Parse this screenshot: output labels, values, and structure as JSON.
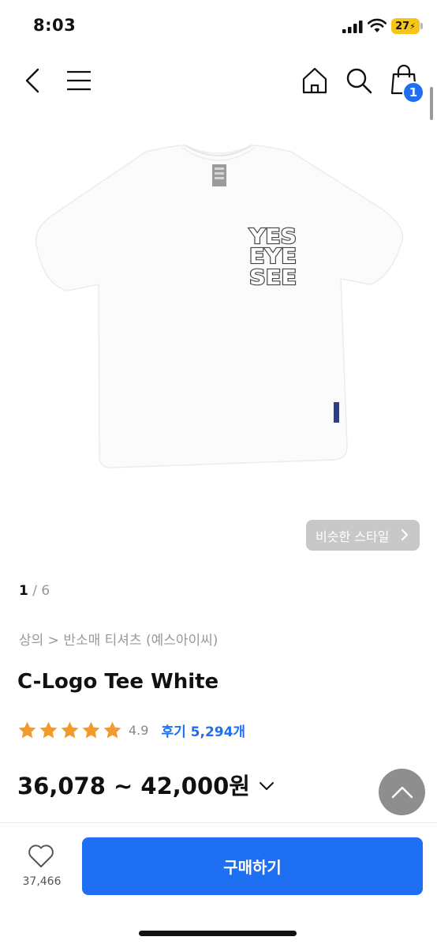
{
  "status_bar": {
    "time": "8:03",
    "battery": "27"
  },
  "nav": {
    "cart_count": "1"
  },
  "product": {
    "graphic_text": [
      "YES",
      "EYE",
      "SEE"
    ],
    "similar_style_label": "비슷한 스타일",
    "pager_current": "1",
    "pager_total": " / 6",
    "breadcrumb": "상의 > 반소매 티셔츠 (예스아이씨)",
    "title": "C-Logo Tee White",
    "rating": 4.9,
    "rating_label": "4.9",
    "reviews_label": "후기 5,294개",
    "price": "36,078 ~ 42,000원"
  },
  "bottom_bar": {
    "like_count": "37,466",
    "buy_label": "구매하기"
  },
  "colors": {
    "accent": "#1e6ff1",
    "star": "#f39a2c"
  }
}
